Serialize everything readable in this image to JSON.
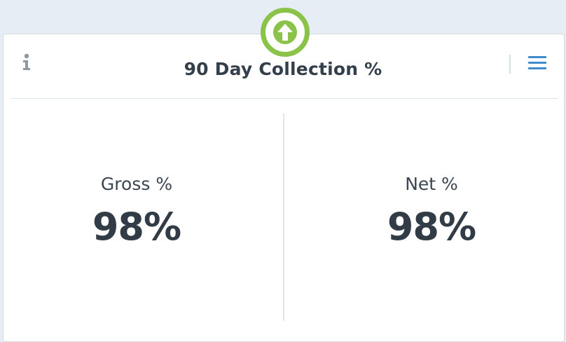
{
  "widget": {
    "title": "90 Day Collection %",
    "trend_icon": "arrow-up-circle-icon",
    "info_icon": "info-icon",
    "menu_icon": "hamburger-menu-icon"
  },
  "metrics": [
    {
      "label": "Gross %",
      "value": "98%"
    },
    {
      "label": "Net %",
      "value": "98%"
    }
  ],
  "colors": {
    "trend_up": "#8bc34a",
    "menu_accent": "#3d8ccd",
    "text_dark": "#333f4a",
    "background": "#e6edf4"
  }
}
